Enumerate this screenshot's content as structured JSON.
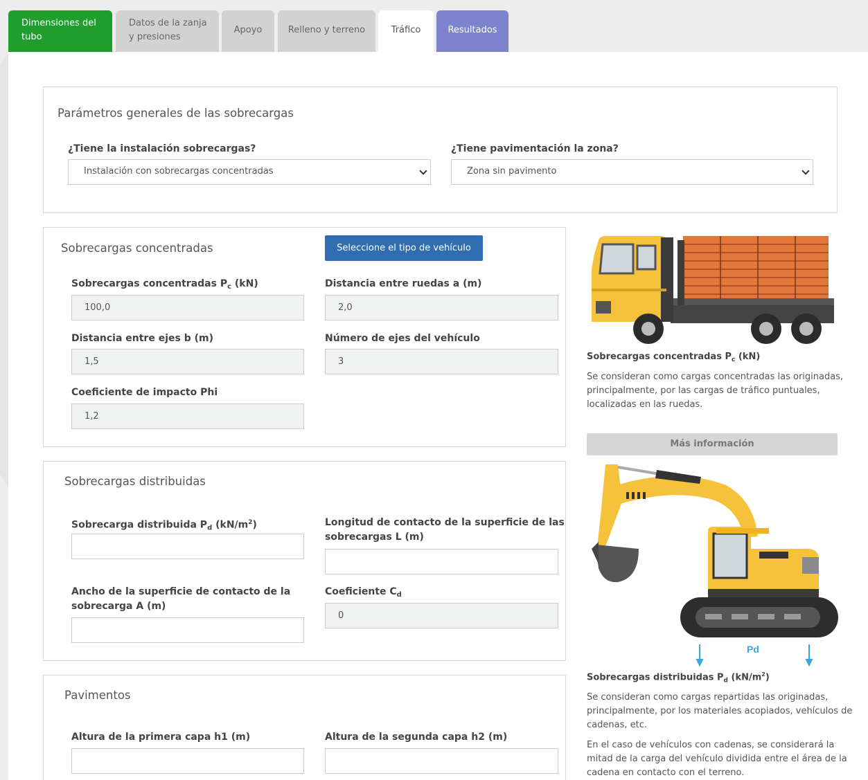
{
  "tabs": [
    {
      "line1": "Dimensiones del",
      "line2": "tubo"
    },
    {
      "line1": "Datos de la zanja",
      "line2": "y presiones"
    },
    {
      "label": "Apoyo"
    },
    {
      "label": "Relleno y terreno"
    },
    {
      "label": "Tráfico"
    },
    {
      "label": "Resultados"
    }
  ],
  "general": {
    "title": "Parámetros generales de las sobrecargas",
    "q1_label": "¿Tiene la instalación sobrecargas?",
    "q1_value": "Instalación con sobrecargas concentradas",
    "q2_label": "¿Tiene pavimentación la zona?",
    "q2_value": "Zona sin pavimento"
  },
  "concentrated": {
    "title": "Sobrecargas concentradas",
    "vehicle_button": "Seleccione el tipo de vehículo",
    "pc_label_a": "Sobrecargas concentradas P",
    "pc_label_sub": "c",
    "pc_label_b": " (kN)",
    "pc_value": "100,0",
    "a_label": "Distancia entre ruedas a (m)",
    "a_value": "2,0",
    "b_label": "Distancia entre ejes b (m)",
    "b_value": "1,5",
    "axes_label": "Número de ejes del vehículo",
    "axes_value": "3",
    "phi_label": "Coeficiente de impacto Phi",
    "phi_value": "1,2"
  },
  "distributed": {
    "title": "Sobrecargas distribuidas",
    "pd_label_a": "Sobrecarga distribuida P",
    "pd_label_sub": "d",
    "pd_label_b": " (kN/m",
    "pd_label_sup": "2",
    "pd_label_c": ")",
    "pd_value": "",
    "l_label_1": "Longitud de contacto de la superficie de las",
    "l_label_2": "sobrecargas L (m)",
    "l_value": "",
    "w_label_1": "Ancho de la superficie de contacto de la",
    "w_label_2": "sobrecarga A (m)",
    "w_value": "",
    "cd_label_a": "Coeficiente C",
    "cd_label_sub": "d",
    "cd_value": "0"
  },
  "pavements": {
    "title": "Pavimentos",
    "h1_label": "Altura de la primera capa h1 (m)",
    "h1_value": "",
    "h2_label": "Altura de la segunda capa h2 (m)",
    "h2_value": ""
  },
  "side": {
    "pc_title_a": "Sobrecargas concentradas P",
    "pc_title_sub": "c",
    "pc_title_b": " (kN)",
    "pc_text_1": "Se consideran como cargas concentradas las originadas,",
    "pc_text_2": "principalmente, por las cargas de tráfico puntuales,",
    "pc_text_3": "localizadas en las ruedas.",
    "more_button": "Más información",
    "pd_diagram_label": "Pd",
    "pd_title_a": "Sobrecargas distribuidas P",
    "pd_title_sub": "d",
    "pd_title_b": " (kN/m",
    "pd_title_sup": "2",
    "pd_title_c": ")",
    "pd_text_1": "Se consideran como cargas repartidas las originadas,",
    "pd_text_2": "principalmente, por los materiales acopiados, vehículos de",
    "pd_text_3": "cadenas, etc.",
    "pd_text_4": "En el caso de vehículos con cadenas, se considerará la",
    "pd_text_5": "mitad de la carga del vehículo dividida entre el área de la",
    "pd_text_6": "cadena en contacto con el terreno."
  },
  "colors": {
    "tab_active_green": "#1e9e2d",
    "tab_results": "#7d83cc",
    "primary_button": "#2f6fb1",
    "truck_yellow": "#f7c23b",
    "pipe_orange": "#e2773b",
    "arrow_blue": "#3aa7e0"
  }
}
